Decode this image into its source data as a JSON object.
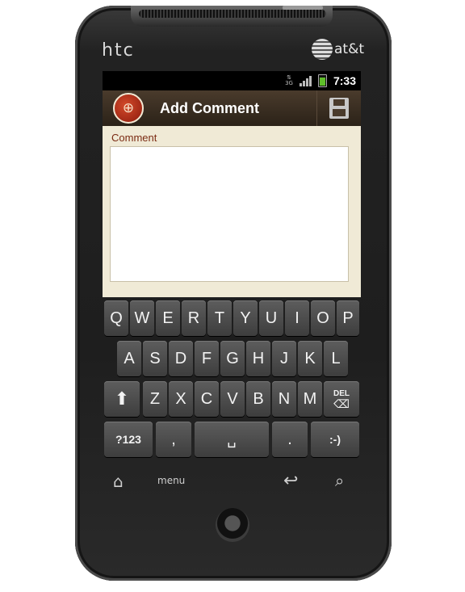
{
  "device": {
    "brand_left": "htc",
    "carrier": "at&t"
  },
  "status_bar": {
    "network": "3G",
    "time": "7:33"
  },
  "app_bar": {
    "title": "Add Comment",
    "app_icon": "globe-logo-icon",
    "save_icon": "floppy-disk-icon"
  },
  "form": {
    "comment_label": "Comment",
    "comment_value": ""
  },
  "keyboard": {
    "row1": [
      "Q",
      "W",
      "E",
      "R",
      "T",
      "Y",
      "U",
      "I",
      "O",
      "P"
    ],
    "row2": [
      "A",
      "S",
      "D",
      "F",
      "G",
      "H",
      "J",
      "K",
      "L"
    ],
    "row3": [
      "Z",
      "X",
      "C",
      "V",
      "B",
      "N",
      "M"
    ],
    "shift_icon": "shift-arrow-icon",
    "delete_label": "DEL",
    "symbols_label": "?123",
    "comma": ",",
    "space_icon": "space-bar-icon",
    "period": ".",
    "smiley": ":-)"
  },
  "nav": {
    "home_icon": "home-icon",
    "menu_label": "menu",
    "back_icon": "back-arrow-icon",
    "search_icon": "search-icon"
  }
}
